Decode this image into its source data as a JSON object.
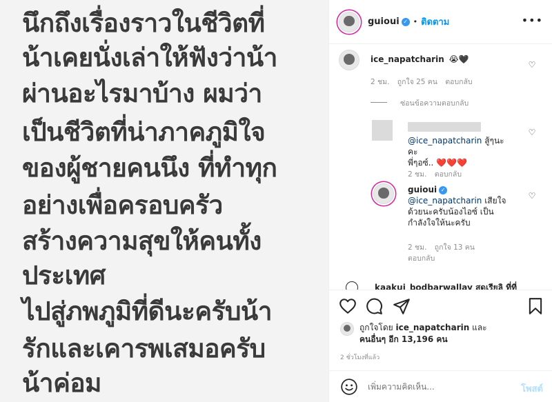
{
  "post": {
    "lines": [
      "นึกถึงเรื่องราวในชีวิตที่",
      "น้าเคยนั่งเล่าให้ฟังว่าน้า",
      "ผ่านอะไรมาบ้าง ผมว่า",
      "เป็นชีวิตที่น่าภาคภูมิใจ",
      "ของผู้ชายคนนึง ที่ทำทุก",
      "อย่างเพื่อครอบครัว",
      "สร้างความสุขให้คนทั้ง",
      "ประเทศ",
      "ไปสู่ภพภูมิที่ดีนะครับน้า",
      "รักและเคารพเสมอครับ",
      "น้าค่อม"
    ]
  },
  "header": {
    "username": "guioui",
    "separator": "•",
    "follow_label": "ติดตาม",
    "more_icon": "more-dots-icon"
  },
  "comments": [
    {
      "username": "ice_napatcharin",
      "text": "😭🖤",
      "time": "2 ชม.",
      "likes": "ถูกใจ 25 คน",
      "reply_label": "ตอบกลับ",
      "hide_replies_label": "ซ่อนข้อความตอบกลับ"
    }
  ],
  "replies": [
    {
      "mention": "@ice_napatcharin",
      "text": " สู้ๆนะคะพี่ๆอซ์.. ❤️❤️❤️",
      "text_line1": " สู้ๆนะคะ",
      "text_line2": "พี่ๆอซ์.. ❤️❤️❤️",
      "time": "2 ชม.",
      "reply_label": "ตอบกลับ"
    },
    {
      "username": "guioui",
      "mention": "@ice_napatcharin",
      "text_line1": " เสียใจ",
      "text_line2": "ด้วยนะครับน้องไอซ์ เป็น",
      "text_line3": "กำลังใจให้นะครับ",
      "time": "2 ชม.",
      "likes": "ถูกใจ 13 คน",
      "reply_label": "ตอบกลับ"
    }
  ],
  "partial_comment": {
    "text": "kaakui_bodbarwallay สุดเรียลิ ที่ที่"
  },
  "likes_info": {
    "liked_by_prefix": "ถูกใจโดย ",
    "liked_by_user": "ice_napatcharin",
    "and_label": " และ",
    "others_label": "คนอื่นๆ อีก 13,196 คน",
    "time_ago": "2 ชั่วโมงที่แล้ว"
  },
  "add_comment": {
    "placeholder": "เพิ่มความคิดเห็น...",
    "post_label": "โพสต์"
  },
  "colors": {
    "blue": "#0095f6",
    "verified": "#3897f0",
    "text": "#262626",
    "meta": "#8e8e8e",
    "post_bg": "#f3f3f3"
  }
}
